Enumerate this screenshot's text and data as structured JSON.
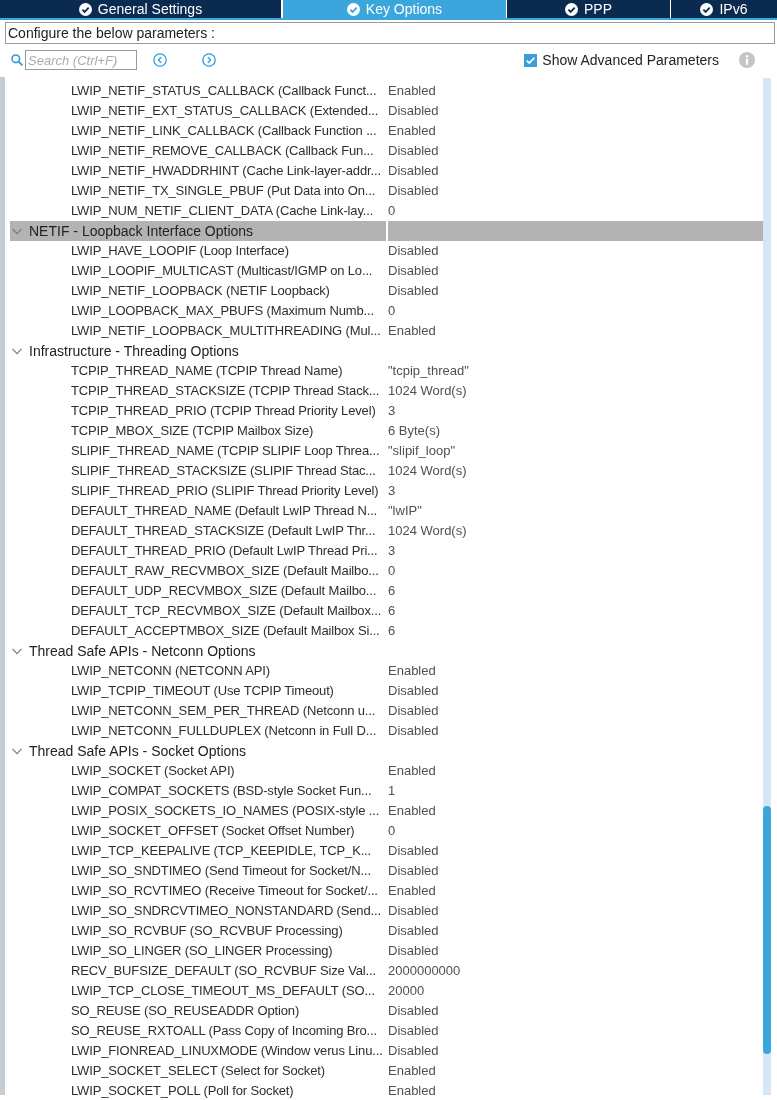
{
  "tabs": [
    {
      "label": "General Settings",
      "selected": false
    },
    {
      "label": "Key Options",
      "selected": true
    },
    {
      "label": "PPP",
      "selected": false
    },
    {
      "label": "IPv6",
      "selected": false
    }
  ],
  "description": "Configure the below parameters :",
  "search": {
    "placeholder": "Search (Ctrl+F)"
  },
  "show_advanced": {
    "label": "Show Advanced Parameters",
    "checked": true
  },
  "parameters": [
    {
      "children": [
        {
          "name": "LWIP_NETIF_STATUS_CALLBACK (Callback Funct...",
          "value": "Enabled",
          "selected": false
        },
        {
          "name": "LWIP_NETIF_EXT_STATUS_CALLBACK (Extended...",
          "value": "Disabled",
          "selected": false
        },
        {
          "name": "LWIP_NETIF_LINK_CALLBACK (Callback Function ...",
          "value": "Enabled",
          "selected": false
        },
        {
          "name": "LWIP_NETIF_REMOVE_CALLBACK (Callback Fun...",
          "value": "Disabled",
          "selected": false
        },
        {
          "name": "LWIP_NETIF_HWADDRHINT (Cache Link-layer-addr...",
          "value": "Disabled",
          "selected": false
        },
        {
          "name": "LWIP_NETIF_TX_SINGLE_PBUF (Put Data into On...",
          "value": "Disabled",
          "selected": false
        },
        {
          "name": "LWIP_NUM_NETIF_CLIENT_DATA (Cache Link-lay...",
          "value": "0",
          "selected": false
        }
      ]
    },
    {
      "label": "NETIF - Loopback Interface Options",
      "expanded": true,
      "selected": true,
      "children": [
        {
          "name": "LWIP_HAVE_LOOPIF (Loop Interface)",
          "value": "Disabled",
          "selected": false
        },
        {
          "name": "LWIP_LOOPIF_MULTICAST (Multicast/IGMP on Lo...",
          "value": "Disabled",
          "selected": false
        },
        {
          "name": "LWIP_NETIF_LOOPBACK (NETIF Loopback)",
          "value": "Disabled",
          "selected": false
        },
        {
          "name": "LWIP_LOOPBACK_MAX_PBUFS (Maximum Numb...",
          "value": "0",
          "selected": false
        },
        {
          "name": "LWIP_NETIF_LOOPBACK_MULTITHREADING (Mul...",
          "value": "Enabled",
          "selected": false
        }
      ]
    },
    {
      "label": "Infrastructure - Threading Options",
      "expanded": true,
      "selected": false,
      "children": [
        {
          "name": "TCPIP_THREAD_NAME (TCPIP Thread Name)",
          "value": "\"tcpip_thread\"",
          "selected": false
        },
        {
          "name": "TCPIP_THREAD_STACKSIZE (TCPIP Thread Stack...",
          "value": "1024 Word(s)",
          "selected": false
        },
        {
          "name": "TCPIP_THREAD_PRIO (TCPIP Thread Priority Level)",
          "value": "3",
          "selected": false
        },
        {
          "name": "TCPIP_MBOX_SIZE (TCPIP Mailbox Size)",
          "value": "6 Byte(s)",
          "selected": false
        },
        {
          "name": "SLIPIF_THREAD_NAME (TCPIP SLIPIF Loop Threa...",
          "value": "\"slipif_loop\"",
          "selected": false
        },
        {
          "name": "SLIPIF_THREAD_STACKSIZE (SLIPIF Thread Stac...",
          "value": "1024 Word(s)",
          "selected": false
        },
        {
          "name": "SLIPIF_THREAD_PRIO (SLIPIF Thread Priority Level)",
          "value": "3",
          "selected": false
        },
        {
          "name": "DEFAULT_THREAD_NAME (Default LwIP Thread N...",
          "value": "\"lwIP\"",
          "selected": false
        },
        {
          "name": "DEFAULT_THREAD_STACKSIZE (Default LwIP Thr...",
          "value": "1024 Word(s)",
          "selected": false
        },
        {
          "name": "DEFAULT_THREAD_PRIO (Default LwIP Thread Pri...",
          "value": "3",
          "selected": false
        },
        {
          "name": "DEFAULT_RAW_RECVMBOX_SIZE (Default Mailbo...",
          "value": "0",
          "selected": false
        },
        {
          "name": "DEFAULT_UDP_RECVMBOX_SIZE (Default Mailbo...",
          "value": "6",
          "selected": false
        },
        {
          "name": "DEFAULT_TCP_RECVMBOX_SIZE (Default Mailbox...",
          "value": "6",
          "selected": false
        },
        {
          "name": "DEFAULT_ACCEPTMBOX_SIZE (Default Mailbox Si...",
          "value": "6",
          "selected": false
        }
      ]
    },
    {
      "label": "Thread Safe APIs - Netconn Options",
      "expanded": true,
      "selected": false,
      "children": [
        {
          "name": "LWIP_NETCONN (NETCONN API)",
          "value": "Enabled",
          "selected": false
        },
        {
          "name": "LWIP_TCPIP_TIMEOUT (Use TCPIP Timeout)",
          "value": "Disabled",
          "selected": false
        },
        {
          "name": "LWIP_NETCONN_SEM_PER_THREAD (Netconn u...",
          "value": "Disabled",
          "selected": false
        },
        {
          "name": "LWIP_NETCONN_FULLDUPLEX (Netconn in Full D...",
          "value": "Disabled",
          "selected": false
        }
      ]
    },
    {
      "label": "Thread Safe APIs - Socket Options",
      "expanded": true,
      "selected": false,
      "children": [
        {
          "name": "LWIP_SOCKET (Socket API)",
          "value": "Enabled",
          "selected": false
        },
        {
          "name": "LWIP_COMPAT_SOCKETS (BSD-style Socket Fun...",
          "value": "1",
          "selected": false
        },
        {
          "name": "LWIP_POSIX_SOCKETS_IO_NAMES (POSIX-style ...",
          "value": "Enabled",
          "selected": false
        },
        {
          "name": "LWIP_SOCKET_OFFSET (Socket Offset Number)",
          "value": "0",
          "selected": false
        },
        {
          "name": "LWIP_TCP_KEEPALIVE (TCP_KEEPIDLE, TCP_K...",
          "value": "Disabled",
          "selected": false
        },
        {
          "name": "LWIP_SO_SNDTIMEO (Send Timeout for Socket/N...",
          "value": "Disabled",
          "selected": false
        },
        {
          "name": "LWIP_SO_RCVTIMEO (Receive Timeout for Socket/...",
          "value": "Enabled",
          "selected": false
        },
        {
          "name": "LWIP_SO_SNDRCVTIMEO_NONSTANDARD (Send...",
          "value": "Disabled",
          "selected": false
        },
        {
          "name": "LWIP_SO_RCVBUF (SO_RCVBUF Processing)",
          "value": "Disabled",
          "selected": false
        },
        {
          "name": "LWIP_SO_LINGER (SO_LINGER Processing)",
          "value": "Disabled",
          "selected": false
        },
        {
          "name": "RECV_BUFSIZE_DEFAULT (SO_RCVBUF Size Val...",
          "value": "2000000000",
          "selected": false
        },
        {
          "name": "LWIP_TCP_CLOSE_TIMEOUT_MS_DEFAULT (SO...",
          "value": "20000",
          "selected": false
        },
        {
          "name": "SO_REUSE (SO_REUSEADDR Option)",
          "value": "Disabled",
          "selected": false
        },
        {
          "name": "SO_REUSE_RXTOALL (Pass Copy of Incoming Bro...",
          "value": "Disabled",
          "selected": false
        },
        {
          "name": "LWIP_FIONREAD_LINUXMODE (Window verus Linu...",
          "value": "Disabled",
          "selected": false
        },
        {
          "name": "LWIP_SOCKET_SELECT (Select for Socket)",
          "value": "Enabled",
          "selected": false
        },
        {
          "name": "LWIP_SOCKET_POLL (Poll for Socket)",
          "value": "Enabled",
          "selected": false
        }
      ]
    }
  ]
}
